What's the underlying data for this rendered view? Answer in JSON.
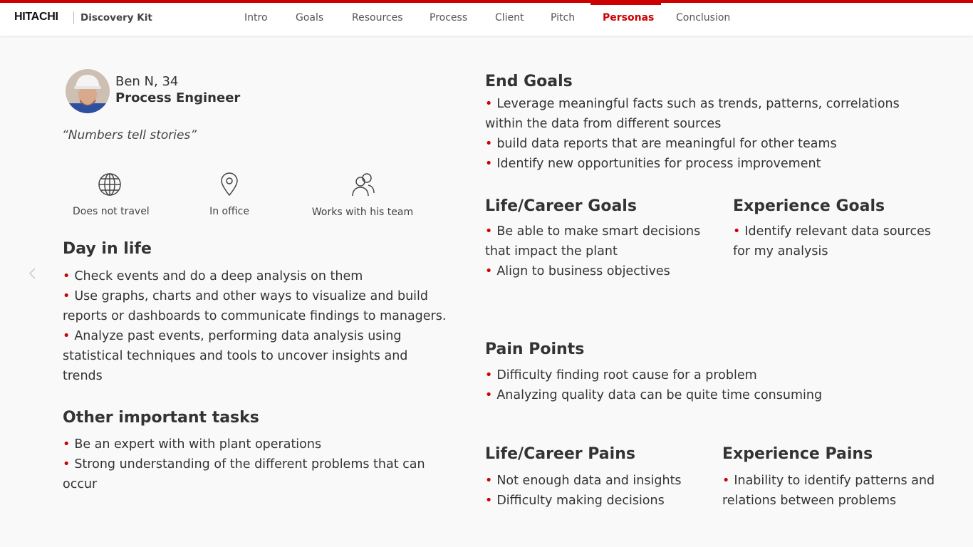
{
  "header": {
    "brand": "HITACHI",
    "product": "Discovery Kit",
    "nav": [
      "Intro",
      "Goals",
      "Resources",
      "Process",
      "Client",
      "Pitch",
      "Personas",
      "Conclusion"
    ],
    "active_nav": "Personas",
    "accent_color": "#cc0000"
  },
  "persona": {
    "name": "Ben N, 34",
    "role": "Process Engineer",
    "quote": "“Numbers tell stories”",
    "attributes": [
      {
        "icon": "globe-icon",
        "label": "Does not travel"
      },
      {
        "icon": "location-pin-icon",
        "label": "In office"
      },
      {
        "icon": "team-icon",
        "label": "Works with his team"
      }
    ]
  },
  "day_in_life": {
    "title": "Day in life",
    "items": [
      "Check events and do a deep analysis on them",
      "Use graphs, charts and other ways to visualize and build reports or dashboards to communicate findings to managers.",
      "Analyze past events, performing data analysis using statistical techniques and tools to uncover insights and trends"
    ]
  },
  "other_tasks": {
    "title": "Other important tasks",
    "items": [
      "Be an expert with with plant operations",
      "Strong understanding of the different problems that can occur"
    ]
  },
  "end_goals": {
    "title": "End Goals",
    "items": [
      "Leverage meaningful facts such as trends, patterns, correlations within the data from different sources",
      "build data reports that are meaningful for other teams",
      "Identify new opportunities for process improvement"
    ]
  },
  "career_goals": {
    "title": "Life/Career Goals",
    "items": [
      "Be able to make smart decisions that impact the plant",
      "Align to business objectives"
    ]
  },
  "experience_goals": {
    "title": "Experience Goals",
    "items": [
      "Identify relevant data sources for my analysis"
    ]
  },
  "pain_points": {
    "title": "Pain Points",
    "items": [
      "Difficulty finding root cause for a problem",
      "Analyzing quality data can be quite time consuming"
    ]
  },
  "career_pains": {
    "title": "Life/Career Pains",
    "items": [
      "Not enough data and insights",
      "Difficulty making decisions"
    ]
  },
  "experience_pains": {
    "title": "Experience Pains",
    "items": [
      "Inability to identify patterns and relations between problems"
    ]
  }
}
